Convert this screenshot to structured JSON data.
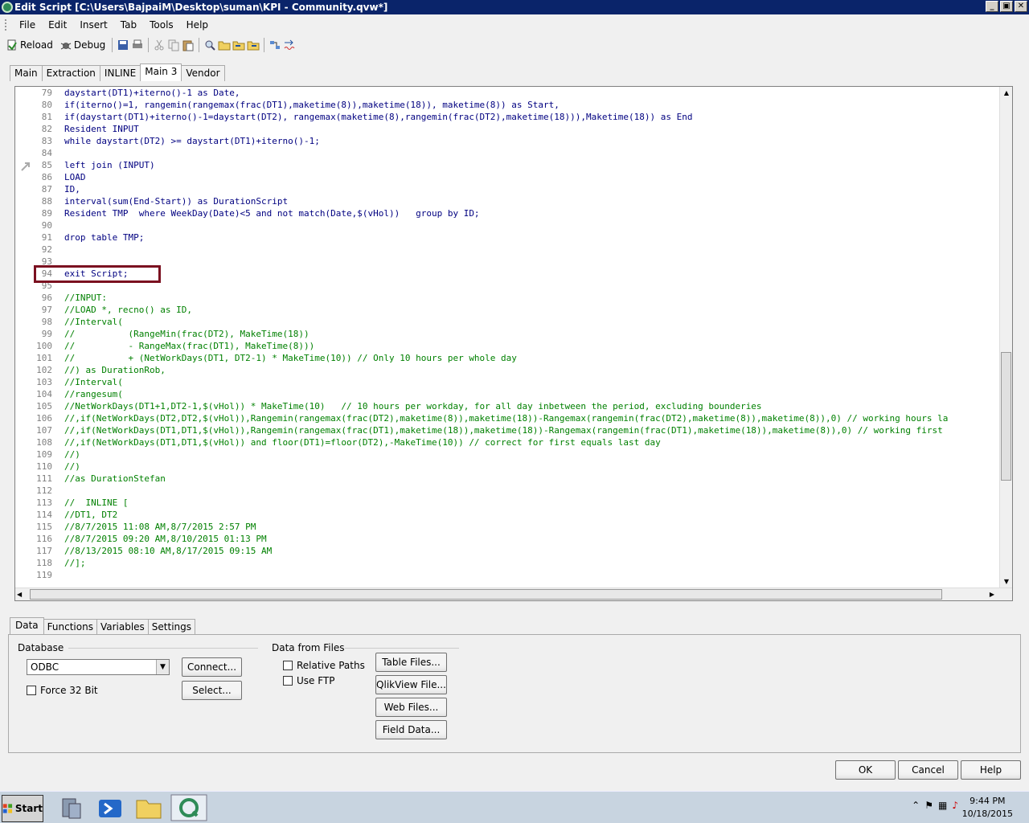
{
  "window": {
    "title": "Edit Script [C:\\Users\\BajpaiM\\Desktop\\suman\\KPI - Community.qvw*]"
  },
  "menu": [
    "File",
    "Edit",
    "Insert",
    "Tab",
    "Tools",
    "Help"
  ],
  "toolbar": {
    "reload_label": "Reload",
    "debug_label": "Debug"
  },
  "script_tabs": [
    "Main",
    "Extraction",
    "INLINE",
    "Main 3",
    "Vendor"
  ],
  "active_script_tab": "Main 3",
  "code": {
    "line_numbers": [
      "79",
      "80",
      "81",
      "82",
      "83",
      "84",
      "85",
      "86",
      "87",
      "88",
      "89",
      "90",
      "91",
      "92",
      "93",
      "94",
      "95",
      "96",
      "97",
      "98",
      "99",
      "100",
      "101",
      "102",
      "103",
      "104",
      "105",
      "106",
      "107",
      "108",
      "109",
      "110",
      "111",
      "112",
      "113",
      "114",
      "115",
      "116",
      "117",
      "118",
      "119"
    ],
    "lines": [
      "daystart(DT1)+iterno()-1 as Date,",
      "if(iterno()=1, rangemin(rangemax(frac(DT1),maketime(8)),maketime(18)), maketime(8)) as Start,",
      "if(daystart(DT1)+iterno()-1=daystart(DT2), rangemax(maketime(8),rangemin(frac(DT2),maketime(18))),Maketime(18)) as End",
      "Resident INPUT",
      "while daystart(DT2) >= daystart(DT1)+iterno()-1;",
      "",
      "left join (INPUT)",
      "LOAD",
      "ID,",
      "interval(sum(End-Start)) as DurationScript",
      "Resident TMP  where WeekDay(Date)<5 and not match(Date,$(vHol))   group by ID;",
      "",
      "drop table TMP;",
      "",
      "",
      "exit Script;",
      "",
      "//INPUT:",
      "//LOAD *, recno() as ID,",
      "//Interval(",
      "//          (RangeMin(frac(DT2), MakeTime(18))",
      "//          - RangeMax(frac(DT1), MakeTime(8)))",
      "//          + (NetWorkDays(DT1, DT2-1) * MakeTime(10)) // Only 10 hours per whole day",
      "//) as DurationRob,",
      "//Interval(",
      "//rangesum(",
      "//NetWorkDays(DT1+1,DT2-1,$(vHol)) * MakeTime(10)   // 10 hours per workday, for all day inbetween the period, excluding bounderies",
      "//,if(NetWorkDays(DT2,DT2,$(vHol)),Rangemin(rangemax(frac(DT2),maketime(8)),maketime(18))-Rangemax(rangemin(frac(DT2),maketime(8)),maketime(8)),0) // working hours la",
      "//,if(NetWorkDays(DT1,DT1,$(vHol)),Rangemin(rangemax(frac(DT1),maketime(18)),maketime(18))-Rangemax(rangemin(frac(DT1),maketime(18)),maketime(8)),0) // working first",
      "//,if(NetWorkDays(DT1,DT1,$(vHol)) and floor(DT1)=floor(DT2),-MakeTime(10)) // correct for first equals last day",
      "//)",
      "//)",
      "//as DurationStefan",
      "",
      "//  INLINE [",
      "//DT1, DT2",
      "//8/7/2015 11:08 AM,8/7/2015 2:57 PM",
      "//8/7/2015 09:20 AM,8/10/2015 01:13 PM",
      "//8/13/2015 08:10 AM,8/17/2015 09:15 AM",
      "//];",
      ""
    ]
  },
  "bottom_tabs": [
    "Data",
    "Functions",
    "Variables",
    "Settings"
  ],
  "active_bottom_tab": "Data",
  "data_panel": {
    "database_label": "Database",
    "database_value": "ODBC",
    "connect_label": "Connect...",
    "select_label": "Select...",
    "force32_label": "Force 32 Bit",
    "files_label": "Data from Files",
    "relative_paths_label": "Relative Paths",
    "use_ftp_label": "Use FTP",
    "table_files_label": "Table Files...",
    "qlikview_file_label": "QlikView File...",
    "web_files_label": "Web Files...",
    "field_data_label": "Field Data..."
  },
  "dialog_buttons": {
    "ok": "OK",
    "cancel": "Cancel",
    "help": "Help"
  },
  "taskbar": {
    "start_label": "Start",
    "time": "9:44 PM",
    "date": "10/18/2015"
  },
  "colors": {
    "titlebar": "#0a246a",
    "keyword": "#00008b",
    "comment": "#008000",
    "highlight_box": "#7b1020"
  }
}
